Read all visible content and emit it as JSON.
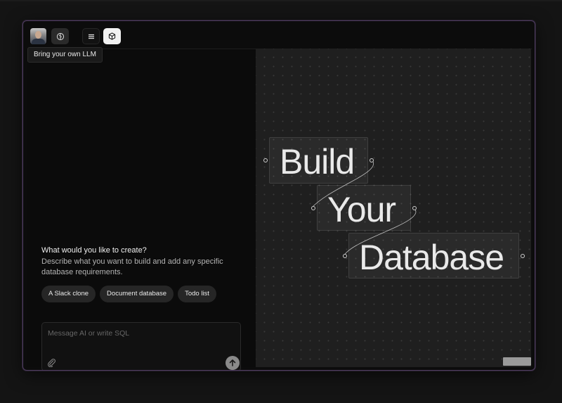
{
  "toolbar": {
    "llm_icon": "brain-icon",
    "menu_icon": "hamburger-icon",
    "cube_icon": "cube-icon"
  },
  "tooltip": "Bring your own LLM",
  "prompt": {
    "title": "What would you like to create?",
    "description": "Describe what you want to build and add any specific database requirements.",
    "suggestions": [
      "A Slack clone",
      "Document database",
      "Todo list"
    ]
  },
  "input": {
    "placeholder": "Message AI or write SQL",
    "attach_icon": "paperclip-icon",
    "send_icon": "arrow-up-icon"
  },
  "hero": {
    "words": [
      "Build",
      "Your",
      "Database"
    ]
  }
}
